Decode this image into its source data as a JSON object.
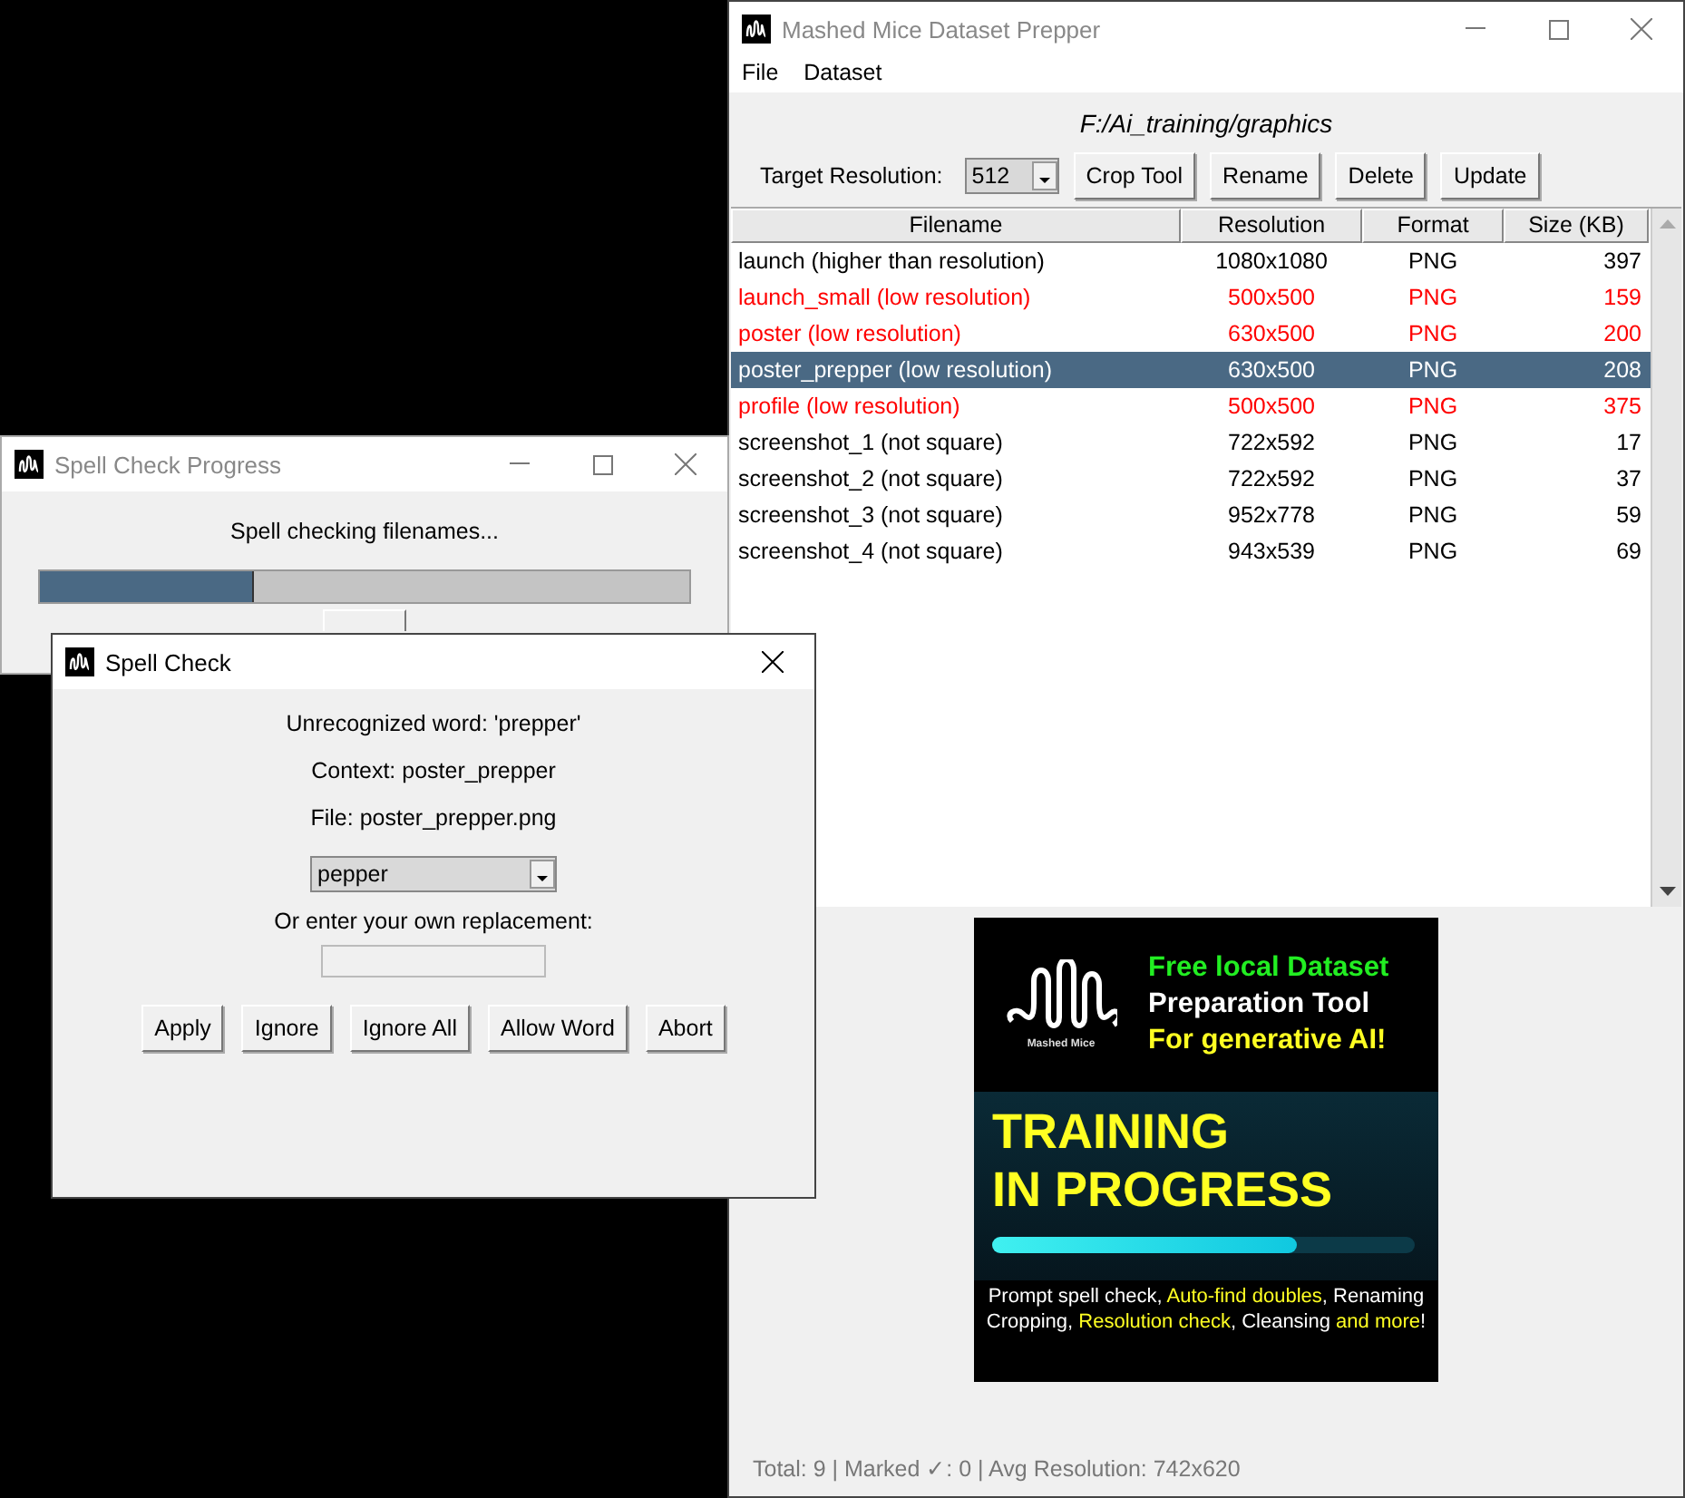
{
  "main_window": {
    "title": "Mashed Mice Dataset Prepper",
    "menu": [
      "File",
      "Dataset"
    ],
    "folder_path": "F:/Ai_training/graphics",
    "target_label": "Target Resolution:",
    "target_value": "512",
    "buttons": [
      "Crop Tool",
      "Rename",
      "Delete",
      "Update"
    ],
    "table": {
      "columns": [
        "Filename",
        "Resolution",
        "Format",
        "Size (KB)"
      ],
      "rows": [
        {
          "cells": [
            "launch (higher than resolution)",
            "1080x1080",
            "PNG",
            "397"
          ],
          "warning": false,
          "selected": false
        },
        {
          "cells": [
            "launch_small (low resolution)",
            "500x500",
            "PNG",
            "159"
          ],
          "warning": true,
          "selected": false
        },
        {
          "cells": [
            "poster (low resolution)",
            "630x500",
            "PNG",
            "200"
          ],
          "warning": true,
          "selected": false
        },
        {
          "cells": [
            "poster_prepper (low resolution)",
            "630x500",
            "PNG",
            "208"
          ],
          "warning": true,
          "selected": true
        },
        {
          "cells": [
            "profile (low resolution)",
            "500x500",
            "PNG",
            "375"
          ],
          "warning": true,
          "selected": false
        },
        {
          "cells": [
            "screenshot_1 (not square)",
            "722x592",
            "PNG",
            "17"
          ],
          "warning": false,
          "selected": false
        },
        {
          "cells": [
            "screenshot_2 (not square)",
            "722x592",
            "PNG",
            "37"
          ],
          "warning": false,
          "selected": false
        },
        {
          "cells": [
            "screenshot_3 (not square)",
            "952x778",
            "PNG",
            "59"
          ],
          "warning": false,
          "selected": false
        },
        {
          "cells": [
            "screenshot_4 (not square)",
            "943x539",
            "PNG",
            "69"
          ],
          "warning": false,
          "selected": false
        }
      ]
    },
    "banner": {
      "logo_caption": "Mashed Mice",
      "tagline": [
        {
          "text": "Free local Dataset",
          "color": "#22ee22"
        },
        {
          "text": "Preparation Tool",
          "color": "#ffffff"
        },
        {
          "text": "For generative AI!",
          "color": "#ffff22"
        }
      ],
      "headline": [
        "TRAINING",
        "IN PROGRESS"
      ],
      "level": 0.72,
      "features": [
        [
          {
            "text": "Prompt spell check, ",
            "highlight": false
          },
          {
            "text": "Auto-find doubles",
            "highlight": true
          },
          {
            "text": ", Renaming",
            "highlight": false
          }
        ],
        [
          {
            "text": "Cropping, ",
            "highlight": false
          },
          {
            "text": "Resolution check",
            "highlight": true
          },
          {
            "text": ", Cleansing ",
            "highlight": false
          },
          {
            "text": "and more",
            "highlight": true
          },
          {
            "text": "!",
            "highlight": false
          }
        ]
      ]
    },
    "status_bar": "Total: 9 | Marked ✓: 0 | Avg Resolution: 742x620"
  },
  "progress_window": {
    "title": "Spell Check Progress",
    "message": "Spell checking filenames...",
    "level": 0.33
  },
  "spell_dialog": {
    "title": "Spell Check",
    "lines": [
      "Unrecognized word: 'prepper'",
      "Context: poster_prepper",
      "File: poster_prepper.png"
    ],
    "suggestion": "pepper",
    "replacement_label": "Or enter your own replacement:",
    "buttons": [
      "Apply",
      "Ignore",
      "Ignore All",
      "Allow Word",
      "Abort"
    ]
  }
}
